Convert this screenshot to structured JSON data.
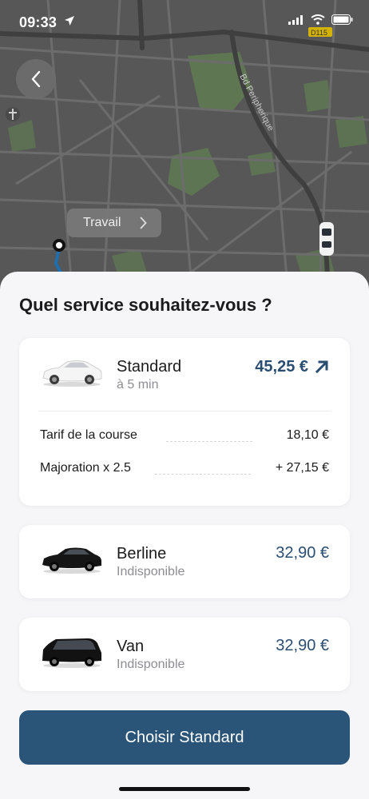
{
  "status_bar": {
    "time": "09:33"
  },
  "map": {
    "road_label": "Bd Peripherique",
    "road_code": "D115",
    "destination_chip": "Travail"
  },
  "sheet": {
    "title": "Quel service souhaitez-vous ?",
    "services": [
      {
        "name": "Standard",
        "subtitle": "à 5 min",
        "price": "45,25 €",
        "surge": true,
        "fare_breakdown": [
          {
            "label": "Tarif de la course",
            "value": "18,10 €"
          },
          {
            "label": "Majoration x 2.5",
            "value": "+ 27,15 €"
          }
        ]
      },
      {
        "name": "Berline",
        "subtitle": "Indisponible",
        "price": "32,90 €"
      },
      {
        "name": "Van",
        "subtitle": "Indisponible",
        "price": "32,90 €"
      }
    ],
    "cta_label": "Choisir Standard"
  },
  "colors": {
    "accent": "#2a5478",
    "price": "#2a4d72",
    "muted": "#8d8d93",
    "map_bg": "#575757",
    "park": "#5f7a52"
  },
  "icons": {
    "back": "chevron-left-icon",
    "chip_arrow": "chevron-right-icon",
    "surge": "arrow-up-right-icon",
    "location": "location-arrow-icon"
  }
}
